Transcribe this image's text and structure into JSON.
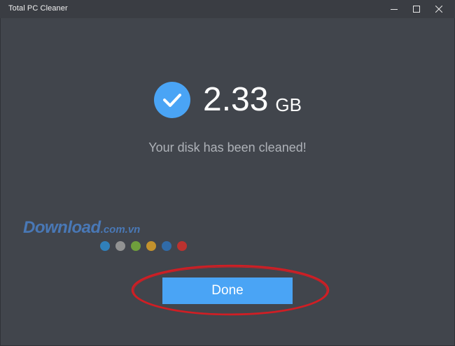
{
  "window": {
    "title": "Total PC Cleaner",
    "controls": [
      "minimize-icon",
      "maximize-icon",
      "close-icon"
    ]
  },
  "result": {
    "icon": "check-circle-icon",
    "value": "2.33",
    "unit": "GB",
    "message": "Your disk has been cleaned!"
  },
  "watermark": {
    "brand": "Download",
    "domain": ".com.vn",
    "dot_colors": [
      "#2f86c6",
      "#9a9a9a",
      "#74a83b",
      "#d19a2a",
      "#2f6fb3",
      "#c9302c"
    ]
  },
  "actions": {
    "done_label": "Done"
  },
  "colors": {
    "background": "#41454c",
    "accent": "#4aa4f5",
    "annotation": "#d01e24"
  }
}
